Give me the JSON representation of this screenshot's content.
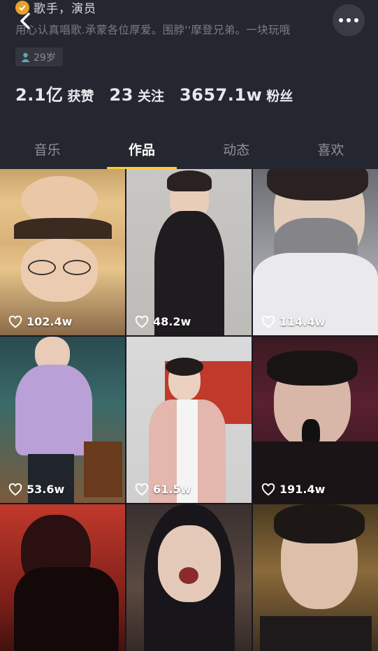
{
  "profile": {
    "occupation": "歌手，演员",
    "bio": "用心认真唱歌.承蒙各位厚爱。围脖''摩登兄弟。一块玩哦",
    "age": "29岁"
  },
  "stats": [
    {
      "num": "2.1亿",
      "label": "获赞"
    },
    {
      "num": "23",
      "label": "关注"
    },
    {
      "num": "3657.1w",
      "label": "粉丝"
    }
  ],
  "tabs": [
    {
      "label": "音乐"
    },
    {
      "label": "作品"
    },
    {
      "label": "动态"
    },
    {
      "label": "喜欢"
    }
  ],
  "active_tab": "作品",
  "videos": [
    {
      "likes": "102.4w"
    },
    {
      "likes": "48.2w"
    },
    {
      "likes": "114.4w"
    },
    {
      "likes": "53.6w"
    },
    {
      "likes": "61.5w"
    },
    {
      "likes": "191.4w"
    },
    {
      "likes": ""
    },
    {
      "likes": ""
    },
    {
      "likes": ""
    }
  ],
  "icons": {
    "back": "chevron-left-icon",
    "more": "more-dots-icon",
    "age": "person-icon",
    "likes": "heart-icon"
  },
  "colors": {
    "tab_indicator": "#facd2d",
    "background": "#161823"
  }
}
